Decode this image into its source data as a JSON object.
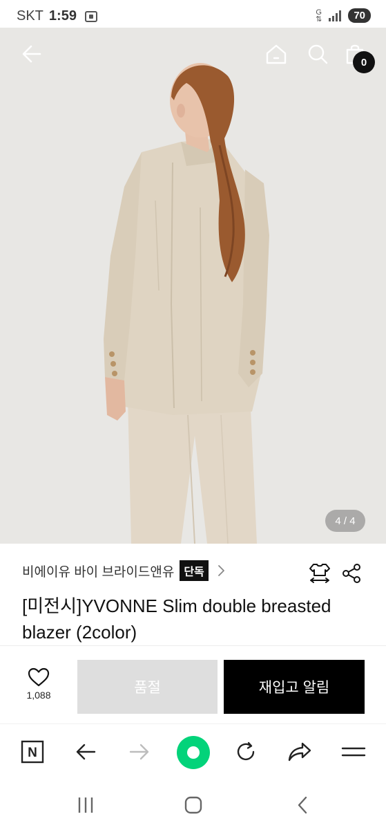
{
  "status_bar": {
    "carrier": "SKT",
    "time": "1:59",
    "network_label": "G",
    "battery": "70"
  },
  "header": {
    "cart_count": "0",
    "icons": [
      "back-arrow-icon",
      "home-icon",
      "search-icon",
      "cart-icon"
    ]
  },
  "gallery": {
    "page_indicator": "4 / 4"
  },
  "product": {
    "brand": "비에이유 바이 브라이드앤유",
    "badge": "단독",
    "title": "[미전시]YVONNE Slim double breasted blazer (2color)"
  },
  "actions": {
    "like_count": "1,088",
    "soldout_label": "품절",
    "restock_label": "재입고 알림"
  },
  "browser_toolbar": {
    "n_label": "N",
    "accent_color": "#03d37a"
  },
  "colors": {
    "background": "#ffffff",
    "primary_button": "#000000",
    "disabled_button": "#dedede"
  }
}
